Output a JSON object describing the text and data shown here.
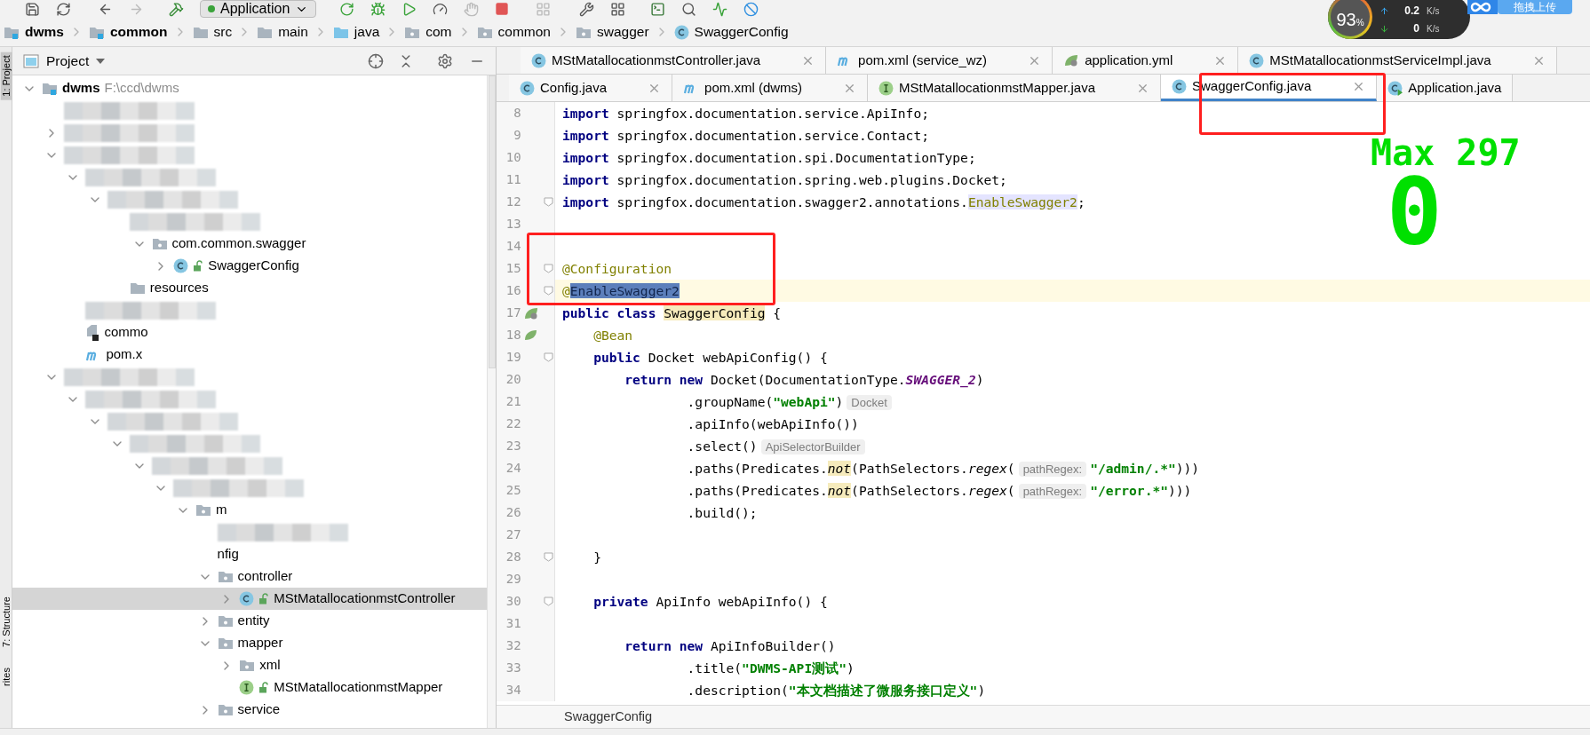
{
  "toolbar": {
    "run_configuration": "Application"
  },
  "network_widget": {
    "cpu": "93",
    "cpu_unit": "%",
    "upload": "0.2",
    "upload_unit": "K/s",
    "download": "0",
    "download_unit": "K/s",
    "upload_button": "拖拽上传"
  },
  "breadcrumbs": [
    {
      "label": "dwms",
      "kind": "module"
    },
    {
      "label": "common",
      "kind": "module"
    },
    {
      "label": "src",
      "kind": "folder"
    },
    {
      "label": "main",
      "kind": "folder"
    },
    {
      "label": "java",
      "kind": "source"
    },
    {
      "label": "com",
      "kind": "package"
    },
    {
      "label": "common",
      "kind": "package"
    },
    {
      "label": "swagger",
      "kind": "package"
    },
    {
      "label": "SwaggerConfig",
      "kind": "class"
    }
  ],
  "tool_strip": [
    {
      "label": "1: Project",
      "selected": true
    },
    {
      "label": "7: Structure",
      "selected": false
    },
    {
      "label": "rites",
      "selected": false
    }
  ],
  "project_panel": {
    "title": "Project",
    "tree": [
      {
        "kind": "module",
        "label": "dwms",
        "detail": "F:\\ccd\\dwms",
        "expanded": true,
        "selected": false,
        "children": [
          {
            "kind": "redacted",
            "selected": false
          },
          {
            "kind": "redacted",
            "expanded": false,
            "selected": false
          },
          {
            "kind": "redacted",
            "expanded": true,
            "selected": false,
            "children": [
              {
                "kind": "redacted",
                "expanded": true,
                "selected": false,
                "children": [
                  {
                    "kind": "redacted",
                    "expanded": true,
                    "selected": false,
                    "children": [
                      {
                        "kind": "redacted",
                        "selected": false,
                        "children": [
                          {
                            "kind": "package",
                            "label": "com.common.swagger",
                            "expanded": true,
                            "selected": false,
                            "children": [
                              {
                                "kind": "class",
                                "label": "SwaggerConfig",
                                "expanded": false,
                                "selected": false
                              }
                            ]
                          }
                        ]
                      },
                      {
                        "kind": "folder",
                        "label": "resources",
                        "selected": false
                      }
                    ]
                  }
                ]
              },
              {
                "kind": "redacted",
                "selected": false
              },
              {
                "kind": "file",
                "label": "commo",
                "selected": false
              },
              {
                "kind": "maven",
                "label": "pom.x",
                "selected": false
              }
            ]
          },
          {
            "kind": "redacted",
            "expanded": true,
            "selected": false,
            "children": [
              {
                "kind": "redacted",
                "expanded": true,
                "selected": false,
                "children": [
                  {
                    "kind": "redacted",
                    "expanded": true,
                    "selected": false,
                    "children": [
                      {
                        "kind": "redacted",
                        "expanded": true,
                        "selected": false,
                        "children": [
                          {
                            "kind": "redacted",
                            "expanded": true,
                            "selected": false,
                            "children": [
                              {
                                "kind": "redacted",
                                "expanded": true,
                                "selected": false,
                                "children": [
                                  {
                                    "kind": "package",
                                    "label": "m",
                                    "expanded": true,
                                    "selected": false,
                                    "children": [
                                      {
                                        "kind": "redacted",
                                        "selected": false
                                      },
                                      {
                                        "kind": "plain",
                                        "label": "nfig",
                                        "selected": false
                                      },
                                      {
                                        "kind": "package",
                                        "label": "controller",
                                        "expanded": true,
                                        "selected": false,
                                        "children": [
                                          {
                                            "kind": "class",
                                            "label": "MStMatallocationmstController",
                                            "expanded": false,
                                            "selected": true
                                          }
                                        ]
                                      },
                                      {
                                        "kind": "package",
                                        "label": "entity",
                                        "expanded": false,
                                        "selected": false
                                      },
                                      {
                                        "kind": "package",
                                        "label": "mapper",
                                        "expanded": true,
                                        "selected": false,
                                        "children": [
                                          {
                                            "kind": "package",
                                            "label": "xml",
                                            "expanded": false,
                                            "selected": false
                                          },
                                          {
                                            "kind": "interface",
                                            "label": "MStMatallocationmstMapper",
                                            "selected": false
                                          }
                                        ]
                                      },
                                      {
                                        "kind": "package",
                                        "label": "service",
                                        "expanded": false,
                                        "selected": false
                                      }
                                    ]
                                  }
                                ]
                              }
                            ]
                          }
                        ]
                      }
                    ]
                  }
                ]
              }
            ]
          }
        ]
      }
    ]
  },
  "editor": {
    "tab_rows": [
      [
        {
          "label": "MStMatallocationmstController.java",
          "kind": "class",
          "selected": false
        },
        {
          "label": "pom.xml (service_wz)",
          "kind": "maven",
          "selected": false
        },
        {
          "label": "application.yml",
          "kind": "yml",
          "selected": false
        },
        {
          "label": "MStMatallocationmstServiceImpl.java",
          "kind": "class",
          "selected": false
        }
      ],
      [
        {
          "label": "Config.java",
          "kind": "class",
          "selected": false
        },
        {
          "label": "pom.xml (dwms)",
          "kind": "maven",
          "selected": false
        },
        {
          "label": "MStMatallocationmstMapper.java",
          "kind": "interface",
          "selected": false
        },
        {
          "label": "SwaggerConfig.java",
          "kind": "class",
          "selected": true
        },
        {
          "label": "Application.java",
          "kind": "run_class",
          "selected": false
        }
      ]
    ],
    "lines": [
      {
        "number": "8",
        "kind": "code",
        "fold": false,
        "current": false,
        "tokens": [
          {
            "kind": "keyword",
            "text": "import"
          },
          {
            "kind": "plain",
            "text": " springfox.documentation.service.ApiInfo;"
          }
        ]
      },
      {
        "number": "9",
        "kind": "code",
        "fold": false,
        "current": false,
        "tokens": [
          {
            "kind": "keyword",
            "text": "import"
          },
          {
            "kind": "plain",
            "text": " springfox.documentation.service.Contact;"
          }
        ]
      },
      {
        "number": "10",
        "kind": "code",
        "fold": false,
        "current": false,
        "tokens": [
          {
            "kind": "keyword",
            "text": "import"
          },
          {
            "kind": "plain",
            "text": " springfox.documentation.spi.DocumentationType;"
          }
        ]
      },
      {
        "number": "11",
        "kind": "code",
        "fold": false,
        "current": false,
        "tokens": [
          {
            "kind": "keyword",
            "text": "import"
          },
          {
            "kind": "plain",
            "text": " springfox.documentation.spring.web.plugins.Docket;"
          }
        ]
      },
      {
        "number": "12",
        "kind": "code",
        "fold": true,
        "current": false,
        "tokens": [
          {
            "kind": "keyword",
            "text": "import"
          },
          {
            "kind": "plain",
            "text": " springfox.documentation.swagger2.annotations."
          },
          {
            "kind": "reference",
            "text": "EnableSwagger2"
          },
          {
            "kind": "plain",
            "text": ";"
          }
        ]
      },
      {
        "number": "13",
        "kind": "code",
        "fold": false,
        "current": false
      },
      {
        "number": "14",
        "kind": "code",
        "fold": false,
        "current": false
      },
      {
        "number": "15",
        "kind": "code",
        "fold": true,
        "current": false,
        "tokens": [
          {
            "kind": "annotation",
            "text": "@Configuration"
          }
        ]
      },
      {
        "number": "16",
        "kind": "code",
        "fold": true,
        "current": true,
        "tokens": [
          {
            "kind": "annotation",
            "text": "@"
          },
          {
            "kind": "selected",
            "text": "EnableSwagger2"
          }
        ]
      },
      {
        "number": "17",
        "kind": "class_bean",
        "fold": false,
        "current": false,
        "tokens": [
          {
            "kind": "keyword",
            "text": "public class "
          },
          {
            "kind": "usage",
            "text": "SwaggerConfig"
          },
          {
            "kind": "plain",
            "text": " {"
          }
        ]
      },
      {
        "number": "18",
        "kind": "bean",
        "fold": false,
        "current": false,
        "tokens": [
          {
            "kind": "annotation",
            "text": "    @Bean"
          }
        ]
      },
      {
        "number": "19",
        "kind": "code",
        "fold": true,
        "current": false,
        "tokens": [
          {
            "kind": "keyword",
            "text": "    public"
          },
          {
            "kind": "plain",
            "text": " Docket webApiConfig() {"
          }
        ]
      },
      {
        "number": "20",
        "kind": "code",
        "fold": false,
        "current": false,
        "tokens": [
          {
            "kind": "keyword",
            "text": "        return new"
          },
          {
            "kind": "plain",
            "text": " Docket(DocumentationType."
          },
          {
            "kind": "constant",
            "text": "SWAGGER_2"
          },
          {
            "kind": "plain",
            "text": ")"
          }
        ]
      },
      {
        "number": "21",
        "kind": "code",
        "fold": false,
        "current": false,
        "tokens": [
          {
            "kind": "plain",
            "text": "                .groupName("
          },
          {
            "kind": "string",
            "text": "\"webApi\""
          },
          {
            "kind": "plain",
            "text": ")"
          },
          {
            "kind": "hint",
            "text": "Docket"
          }
        ]
      },
      {
        "number": "22",
        "kind": "code",
        "fold": false,
        "current": false,
        "tokens": [
          {
            "kind": "plain",
            "text": "                .apiInfo(webApiInfo())"
          }
        ]
      },
      {
        "number": "23",
        "kind": "code",
        "fold": false,
        "current": false,
        "tokens": [
          {
            "kind": "plain",
            "text": "                .select()"
          },
          {
            "kind": "hint",
            "text": "ApiSelectorBuilder"
          }
        ]
      },
      {
        "number": "24",
        "kind": "code",
        "fold": false,
        "current": false,
        "tokens": [
          {
            "kind": "plain",
            "text": "                .paths(Predicates."
          },
          {
            "kind": "usage_italic",
            "text": "not"
          },
          {
            "kind": "plain",
            "text": "(PathSelectors."
          },
          {
            "kind": "italic",
            "text": "regex"
          },
          {
            "kind": "plain",
            "text": "("
          },
          {
            "kind": "hint",
            "text": "pathRegex:"
          },
          {
            "kind": "string",
            "text": "\"/admin/.*\""
          },
          {
            "kind": "plain",
            "text": ")))"
          }
        ]
      },
      {
        "number": "25",
        "kind": "code",
        "fold": false,
        "current": false,
        "tokens": [
          {
            "kind": "plain",
            "text": "                .paths(Predicates."
          },
          {
            "kind": "usage_italic",
            "text": "not"
          },
          {
            "kind": "plain",
            "text": "(PathSelectors."
          },
          {
            "kind": "italic",
            "text": "regex"
          },
          {
            "kind": "plain",
            "text": "("
          },
          {
            "kind": "hint",
            "text": "pathRegex:"
          },
          {
            "kind": "string",
            "text": "\"/error.*\""
          },
          {
            "kind": "plain",
            "text": ")))"
          }
        ]
      },
      {
        "number": "26",
        "kind": "code",
        "fold": false,
        "current": false,
        "tokens": [
          {
            "kind": "plain",
            "text": "                .build();"
          }
        ]
      },
      {
        "number": "27",
        "kind": "code",
        "fold": false,
        "current": false
      },
      {
        "number": "28",
        "kind": "code",
        "fold": true,
        "current": false,
        "tokens": [
          {
            "kind": "plain",
            "text": "    }"
          }
        ]
      },
      {
        "number": "29",
        "kind": "code",
        "fold": false,
        "current": false
      },
      {
        "number": "30",
        "kind": "code",
        "fold": true,
        "current": false,
        "tokens": [
          {
            "kind": "keyword",
            "text": "    private"
          },
          {
            "kind": "plain",
            "text": " ApiInfo webApiInfo() {"
          }
        ]
      },
      {
        "number": "31",
        "kind": "code",
        "fold": false,
        "current": false
      },
      {
        "number": "32",
        "kind": "code",
        "fold": false,
        "current": false,
        "tokens": [
          {
            "kind": "keyword",
            "text": "        return new"
          },
          {
            "kind": "plain",
            "text": " ApiInfoBuilder()"
          }
        ]
      },
      {
        "number": "33",
        "kind": "code",
        "fold": false,
        "current": false,
        "tokens": [
          {
            "kind": "plain",
            "text": "                .title("
          },
          {
            "kind": "string",
            "text": "\"DWMS-API测试\""
          },
          {
            "kind": "plain",
            "text": ")"
          }
        ]
      },
      {
        "number": "34",
        "kind": "code",
        "fold": false,
        "current": false,
        "tokens": [
          {
            "kind": "plain",
            "text": "                .description("
          },
          {
            "kind": "string",
            "text": "\"本文档描述了微服务接口定义\""
          },
          {
            "kind": "plain",
            "text": ")"
          }
        ]
      }
    ],
    "breadcrumb": "SwaggerConfig"
  },
  "overlay": {
    "label": "Max 297",
    "value": "0"
  }
}
